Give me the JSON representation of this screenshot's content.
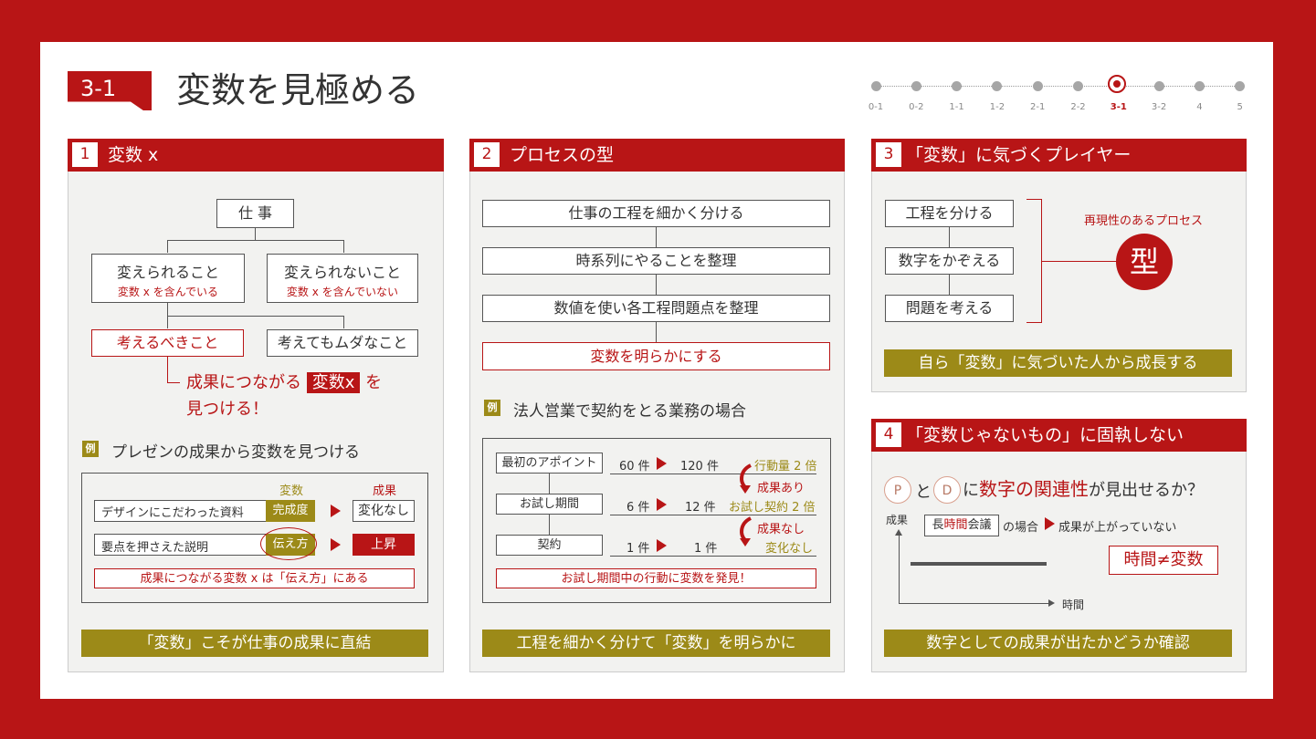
{
  "header": {
    "section": "3-1",
    "title": "変数を見極める"
  },
  "progress": {
    "steps": [
      "0-1",
      "0-2",
      "1-1",
      "1-2",
      "2-1",
      "2-2",
      "3-1",
      "3-2",
      "4",
      "5"
    ],
    "current": "3-1"
  },
  "colors": {
    "primary": "#b81516",
    "olive": "#9c8a18"
  },
  "panel1": {
    "num": "1",
    "title": "変数 x",
    "tree": {
      "root": "仕 事",
      "left": "変えられること",
      "left_sub": "変数 x を含んでいる",
      "right": "変えられないこと",
      "right_sub": "変数 x を含んでいない",
      "think": "考えるべきこと",
      "waste": "考えてもムダなこと",
      "result_a": "成果につながる",
      "result_var": "変数x",
      "result_b": "を",
      "result_c": "見つける！"
    },
    "example_tag": "例",
    "example_title": "プレゼンの成果から変数を見つける",
    "table": {
      "col_var": "変数",
      "col_result": "成果",
      "rows": [
        {
          "label": "デザインにこだわった資料",
          "var": "完成度",
          "result": "変化なし"
        },
        {
          "label": "要点を押さえた説明",
          "var": "伝え方",
          "result": "上昇"
        }
      ],
      "conclusion": "成果につながる変数 x は「伝え方」にある"
    },
    "footer": "「変数」こそが仕事の成果に直結"
  },
  "panel2": {
    "num": "2",
    "title": "プロセスの型",
    "steps": [
      "仕事の工程を細かく分ける",
      "時系列にやることを整理",
      "数値を使い各工程問題点を整理",
      "変数を明らかにする"
    ],
    "example_tag": "例",
    "example_title": "法人営業で契約をとる業務の場合",
    "table": {
      "rows": [
        {
          "label": "最初のアポイント",
          "before": "60 件",
          "after": "120 件"
        },
        {
          "label": "お試し期間",
          "before": "6 件",
          "after": "12 件"
        },
        {
          "label": "契約",
          "before": "1 件",
          "after": "1 件"
        }
      ],
      "notes": [
        "行動量 2 倍",
        "成果あり",
        "お試し契約 2 倍",
        "成果なし",
        "変化なし"
      ],
      "conclusion": "お試し期間中の行動に変数を発見！"
    },
    "footer": "工程を細かく分けて「変数」を明らかに"
  },
  "panel3": {
    "num": "3",
    "title": "「変数」に気づくプレイヤー",
    "steps": [
      "工程を分ける",
      "数字をかぞえる",
      "問題を考える"
    ],
    "label": "再現性のあるプロセス",
    "kata": "型",
    "footer": "自ら「変数」に気づいた人から成長する"
  },
  "panel4": {
    "num": "4",
    "title": "「変数じゃないもの」に固執しない",
    "p": "P",
    "to": "と",
    "d": "D",
    "ni": "に",
    "relation": "数字の関連性",
    "question": "が見出せるか？",
    "y_axis": "成果",
    "x_axis": "時間",
    "meeting_a": "長",
    "meeting_b": "時間",
    "meeting_c": "会議",
    "case": "の場合",
    "not_rising": "成果が上がっていない",
    "verdict": "時間≠変数",
    "footer": "数字としての成果が出たかどうか確認"
  }
}
